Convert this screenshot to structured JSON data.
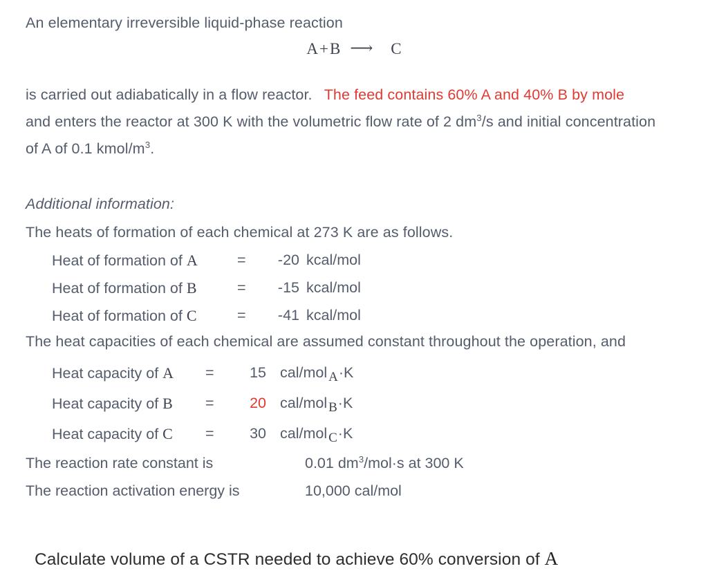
{
  "document": {
    "background_color": "#ffffff",
    "body_text_color": "#545c6b",
    "accent_color": "#df3b33",
    "question_color": "#2e2e2e"
  },
  "intro": {
    "line1": "An elementary irreversible liquid-phase reaction",
    "equation": {
      "reactant_a": "A",
      "plus": "+",
      "reactant_b": "B",
      "arrow": "⟶",
      "product_c": "C"
    }
  },
  "statement": {
    "line2_plain": "is carried out adiabatically in a flow reactor.",
    "line2_red": "The feed contains 60% A and 40% B by mole",
    "line3_pre": "and enters the reactor at 300 K with the volumetric flow rate of 2 dm",
    "line3_sup": "3",
    "line3_post": "/s and initial concentration",
    "line4_pre": "of A of 0.1 kmol/m",
    "line4_sup": "3",
    "line4_post": "."
  },
  "additional": {
    "heading": "Additional information:",
    "heats_intro": "The heats of formation of each chemical at 273 K are as follows.",
    "heats_rows": [
      {
        "label": "Heat of formation of",
        "species": "A",
        "eq": "=",
        "value": "-20",
        "units": "kcal/mol"
      },
      {
        "label": "Heat of formation of",
        "species": "B",
        "eq": "=",
        "value": "-15",
        "units": "kcal/mol"
      },
      {
        "label": "Heat of formation of",
        "species": "C",
        "eq": "=",
        "value": "-41",
        "units": "kcal/mol"
      }
    ],
    "capacities_intro": "The heat capacities of each chemical are assumed constant throughout the operation, and",
    "capacity_rows": [
      {
        "label": "Heat capacity of",
        "species": "A",
        "eq": "=",
        "value": "15",
        "units_pre": "cal/mol",
        "units_sub": "A",
        "units_post": "·K",
        "highlight": false
      },
      {
        "label": "Heat capacity of",
        "species": "B",
        "eq": "=",
        "value": "20",
        "units_pre": "cal/mol",
        "units_sub": "B",
        "units_post": "·K",
        "highlight": true
      },
      {
        "label": "Heat capacity of",
        "species": "C",
        "eq": "=",
        "value": "30",
        "units_pre": "cal/mol",
        "units_sub": "C",
        "units_post": "·K",
        "highlight": false
      }
    ],
    "rate_constant": {
      "label": "The reaction rate constant is",
      "value_pre": "0.01 dm",
      "value_sup": "3",
      "value_post": "/mol·s at 300 K"
    },
    "activation_energy": {
      "label": "The reaction activation energy is",
      "value": "10,000 cal/mol"
    }
  },
  "question": {
    "text_pre": "Calculate volume of a CSTR needed to achieve 60% conversion of",
    "species": "A"
  }
}
